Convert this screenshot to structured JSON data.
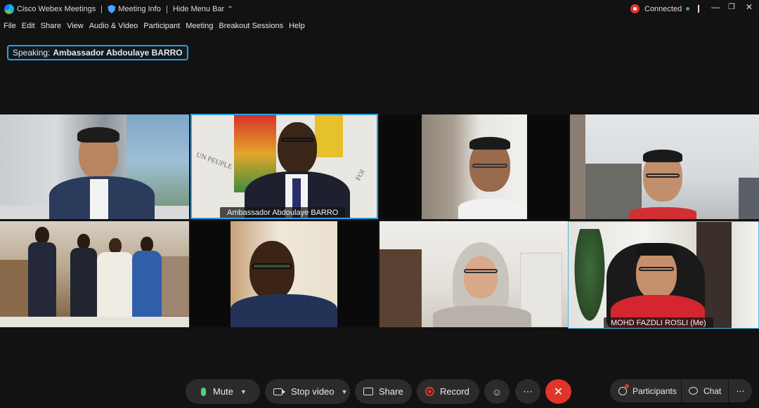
{
  "titlebar": {
    "app_name": "Cisco Webex Meetings",
    "meeting_info": "Meeting Info",
    "hide_menu": "Hide Menu Bar",
    "status": "Connected"
  },
  "menu": [
    "File",
    "Edit",
    "Share",
    "View",
    "Audio & Video",
    "Participant",
    "Meeting",
    "Breakout Sessions",
    "Help"
  ],
  "speaking": {
    "prefix": "Speaking:",
    "name": "Ambassador Abdoulaye BARRO"
  },
  "tiles": {
    "active_name": "Ambassador Abdoulaye BARRO",
    "self_name": "MOHD FAZDLI ROSLI  (Me)",
    "flag_text_left": "UN PEUPLE",
    "flag_text_right": "FOI"
  },
  "controls": {
    "mute": "Mute",
    "stop_video": "Stop video",
    "share": "Share",
    "record": "Record",
    "participants": "Participants",
    "chat": "Chat"
  },
  "colors": {
    "accent": "#2d9fe0",
    "record_red": "#e0352b",
    "mic_green": "#4bd37a"
  }
}
